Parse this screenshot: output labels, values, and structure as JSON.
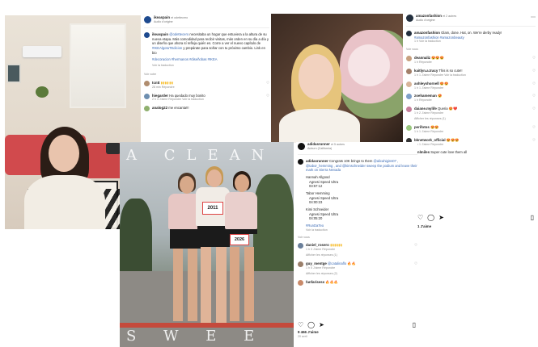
{
  "post1": {
    "username": "ikeaspain",
    "with": "et odettecero",
    "audio": "Audio d'origine",
    "caption_user": "ikeaspain",
    "caption_mention": "@odettecero",
    "caption": "necesitaba un hogar que estuviera a la altura de su nueva etapa. Más comodidad para recibir visitas, más orden en su día a día y un diseño que ahora sí refleja quién es. Corre a ver el nuevo capítulo de",
    "caption_tag": "#IKEAlgotaTEdicion",
    "caption_end": "y prepárate para soñar con tu próximo cambio. Link en bio",
    "hashtags": "#decoracion #hermanos #diseñobas #IKEA",
    "translation": "Voir la traduction",
    "view_replies": "Voir votre",
    "comments": [
      {
        "user": "tcntt",
        "text": "🙌🙌🙌",
        "time": "28 min",
        "reply": "Répondre"
      },
      {
        "user": "hiegarder",
        "text": "Ha quedado muy bonito",
        "time": "2 h",
        "likes": "4 J'aime",
        "reply": "Répondre",
        "translate": "Voir la traduction"
      },
      {
        "user": "analog22",
        "text": "me encanta!!!",
        "time": "",
        "reply": ""
      }
    ]
  },
  "post2": {
    "username": "amazonfashion",
    "with": "et 2 autres",
    "audio": "Audio d'origine",
    "caption_user": "amazonfashion",
    "caption": "Glam, done. Hat, on. We're derby ready!",
    "caption_tags": "#amazonfashion #amazonbeauty",
    "caption_time": "1 h",
    "translation": "Voir la traduction",
    "view_more": "Voir vous",
    "comments": [
      {
        "user": "deannaliz",
        "text": "😍😍😍",
        "time": "1 h",
        "reply": "Répondre"
      },
      {
        "user": "kaitlyn.a.tracy",
        "text": "This is so cute!!",
        "time": "1 h",
        "likes": "1 J'aime",
        "reply": "Répondre",
        "translate": "Voir la traduction"
      },
      {
        "user": "ashleyshornell",
        "text": "😍😍",
        "time": "1 h",
        "likes": "1 J'aime",
        "reply": "Répondre"
      },
      {
        "user": "zoehameman",
        "text": "😍",
        "time": "1 h",
        "reply": "Répondre"
      },
      {
        "user": "daiane.mylife",
        "text": "Queria 😍❤️",
        "time": "1 h",
        "likes": "2 J'aime",
        "reply": "Répondre"
      },
      {
        "user": "",
        "text": "",
        "time": "",
        "reply": "Afficher les réponses (1)"
      },
      {
        "user": "perifotos",
        "text": "😍😍",
        "time": "1 h",
        "likes": "1 J'aime",
        "reply": "Répondre"
      },
      {
        "user": "bknetwork_official",
        "text": "😍😍😍",
        "time": "1 h",
        "likes": "1 J'aime",
        "reply": "Répondre"
      },
      {
        "user": "gmlmiles",
        "text": "Super cute love them all",
        "time": "",
        "reply": ""
      }
    ],
    "likes_label": "1 J'aime"
  },
  "post3": {
    "username": "adidasrunner",
    "with": "et 5 autres",
    "location": "Auburn (California)",
    "caption_user": "adidasrunner",
    "caption": "Congrats 10K brings to them",
    "caption_mentions": "@alicahigins07 , @tabor_hemming , and @kimschneider sweep the podium and leave their mark on Sierra Nevada",
    "results": [
      {
        "name": "Hannah Allgood",
        "race": "Agnesi Speed Ultra",
        "time": "03:57:12"
      },
      {
        "name": "Tabor Hemming",
        "race": "Agnesi Speed Ultra",
        "time": "04:00:23"
      },
      {
        "name": "Kimi Schneider",
        "race": "Agnesi Speed Ultra",
        "time": "04:05:20"
      }
    ],
    "hashtag": "#RunDaTeo",
    "translation": "Voir la traduction",
    "view_more": "Voir vous",
    "comments": [
      {
        "user": "daniel_rosero",
        "text": "🙌🙌🙌",
        "time": "1 h",
        "likes": "3 J'aime",
        "reply": "Répondre"
      },
      {
        "user": "",
        "text": "",
        "time": "",
        "reply": "Afficher les réponses (1)"
      },
      {
        "user": "guy_mentge",
        "text": "@catalinaflo 🔥🔥",
        "time": "1 h",
        "likes": "5 J'aime",
        "reply": "Répondre"
      },
      {
        "user": "",
        "text": "",
        "time": "",
        "reply": "Afficher les réponses (2)"
      },
      {
        "user": "fanfarisess",
        "text": "🔥🔥🔥",
        "time": "",
        "reply": ""
      }
    ],
    "likes_label": "9 466 J'aime",
    "posted": "20 avril",
    "overlay_top": "A CLEAN",
    "overlay_bottom": "S W E E P",
    "bib_1": "2011",
    "bib_2": "2026"
  },
  "icons": {
    "heart": "heart-icon",
    "comment": "comment-icon",
    "share": "share-icon",
    "save": "bookmark-icon"
  },
  "colors": {
    "link": "#3a6ab5",
    "sofa": "#d14a4d"
  }
}
